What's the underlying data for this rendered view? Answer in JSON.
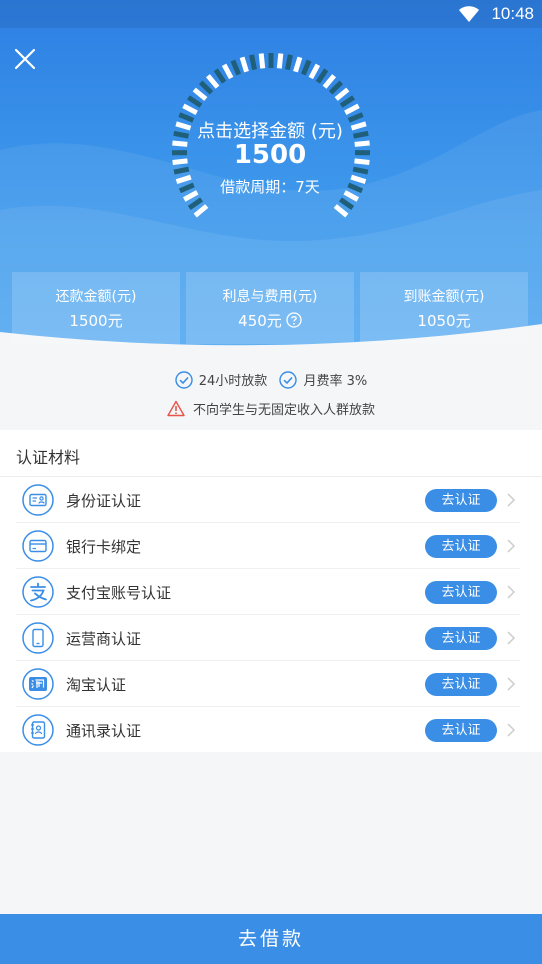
{
  "status": {
    "time": "10:48"
  },
  "gauge": {
    "title": "点击选择金额 (元)",
    "amount": "1500",
    "period": "借款周期：7天"
  },
  "cards": [
    {
      "label": "还款金额(元)",
      "value": "1500元"
    },
    {
      "label": "利息与费用(元)",
      "value": "450元"
    },
    {
      "label": "到账金额(元)",
      "value": "1050元"
    }
  ],
  "features": {
    "item1": "24小时放款",
    "item2": "月费率 3%",
    "warning": "不向学生与无固定收入人群放款"
  },
  "auth": {
    "title": "认证材料",
    "items": [
      {
        "label": "身份证认证",
        "action": "去认证",
        "icon": "id-card-icon"
      },
      {
        "label": "银行卡绑定",
        "action": "去认证",
        "icon": "bank-card-icon"
      },
      {
        "label": "支付宝账号认证",
        "action": "去认证",
        "icon": "alipay-icon"
      },
      {
        "label": "运营商认证",
        "action": "去认证",
        "icon": "phone-icon"
      },
      {
        "label": "淘宝认证",
        "action": "去认证",
        "icon": "taobao-icon"
      },
      {
        "label": "通讯录认证",
        "action": "去认证",
        "icon": "contacts-icon"
      }
    ]
  },
  "footer": {
    "submit": "去借款"
  },
  "colors": {
    "primary": "#3a8ee6",
    "header_top": "#2d7fe3",
    "warning": "#e5534b"
  }
}
